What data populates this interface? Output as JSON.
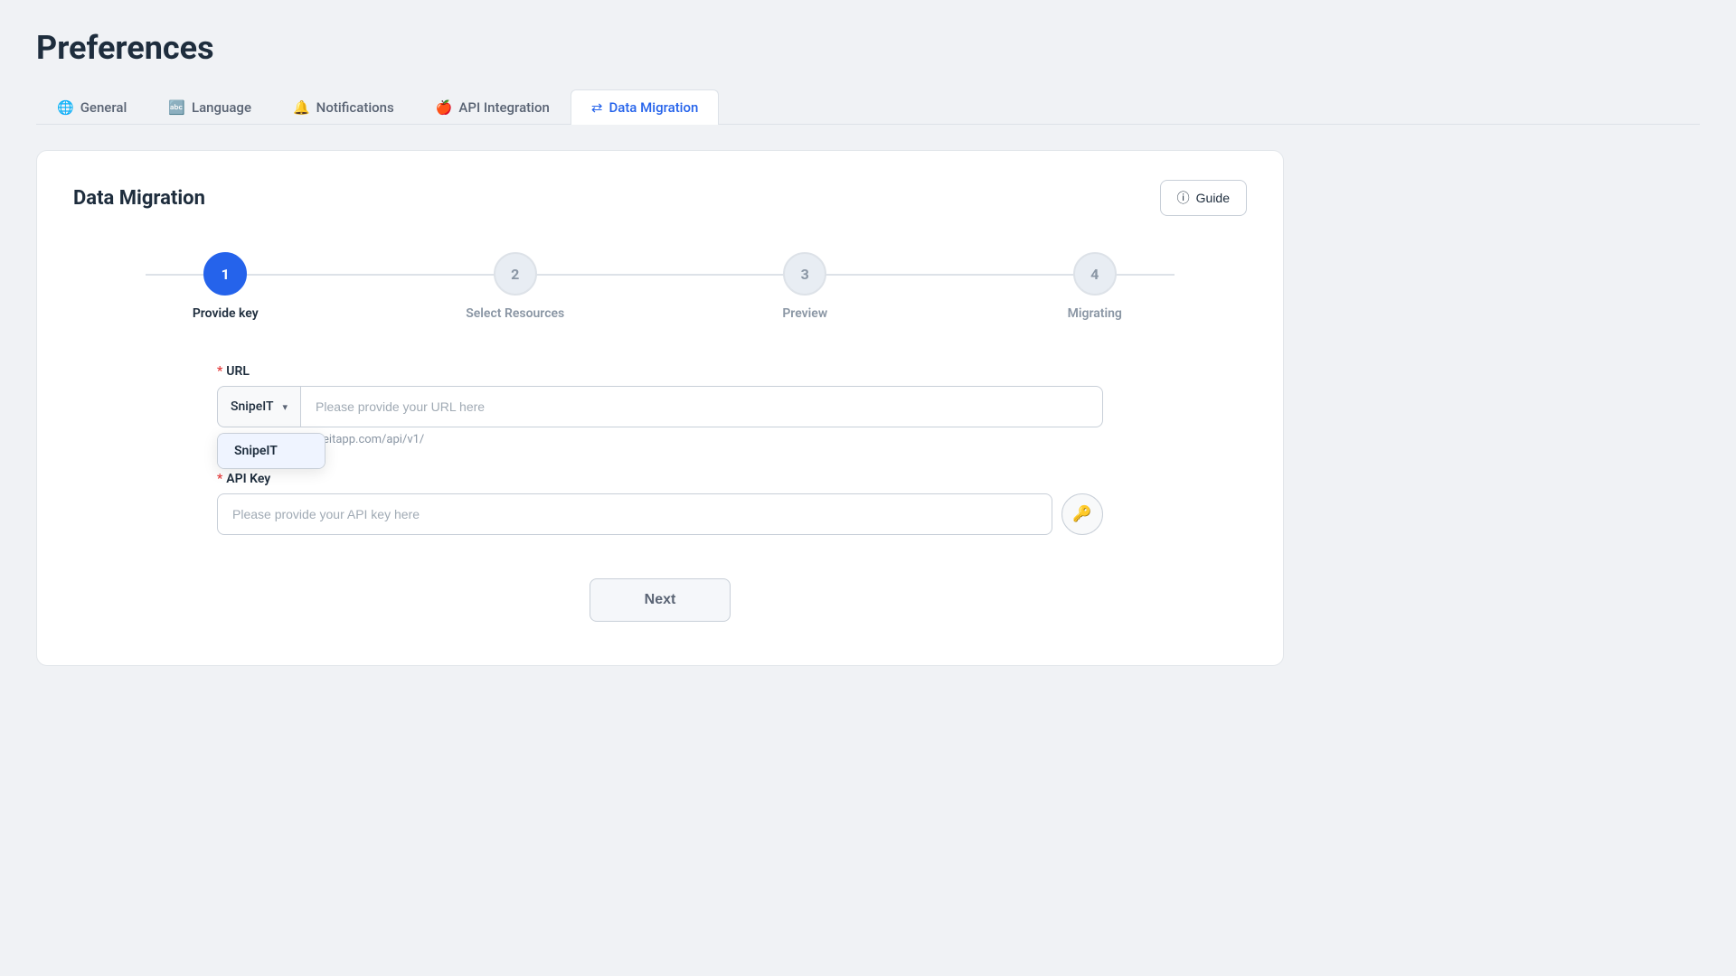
{
  "page": {
    "title": "Preferences"
  },
  "tabs": [
    {
      "id": "general",
      "label": "General",
      "icon": "🌐",
      "active": false
    },
    {
      "id": "language",
      "label": "Language",
      "icon": "🔤",
      "active": false
    },
    {
      "id": "notifications",
      "label": "Notifications",
      "icon": "🔔",
      "active": false
    },
    {
      "id": "api-integration",
      "label": "API Integration",
      "icon": "🍎",
      "active": false
    },
    {
      "id": "data-migration",
      "label": "Data Migration",
      "icon": "⇄",
      "active": true
    }
  ],
  "card": {
    "title": "Data Migration",
    "guide_button": "Guide"
  },
  "stepper": {
    "steps": [
      {
        "number": "1",
        "label": "Provide key",
        "active": true
      },
      {
        "number": "2",
        "label": "Select Resources",
        "active": false
      },
      {
        "number": "3",
        "label": "Preview",
        "active": false
      },
      {
        "number": "4",
        "label": "Migrating",
        "active": false
      }
    ]
  },
  "form": {
    "url_label": "URL",
    "url_required": "*",
    "url_select_value": "SnipeIT",
    "url_placeholder": "Please provide your URL here",
    "url_hint": "https://develop.snipeitapp.com/api/v1/",
    "dropdown_item": "SnipeIT",
    "api_key_label": "API Key",
    "api_key_required": "*",
    "api_key_placeholder": "Please provide your API key here",
    "next_button": "Next"
  }
}
